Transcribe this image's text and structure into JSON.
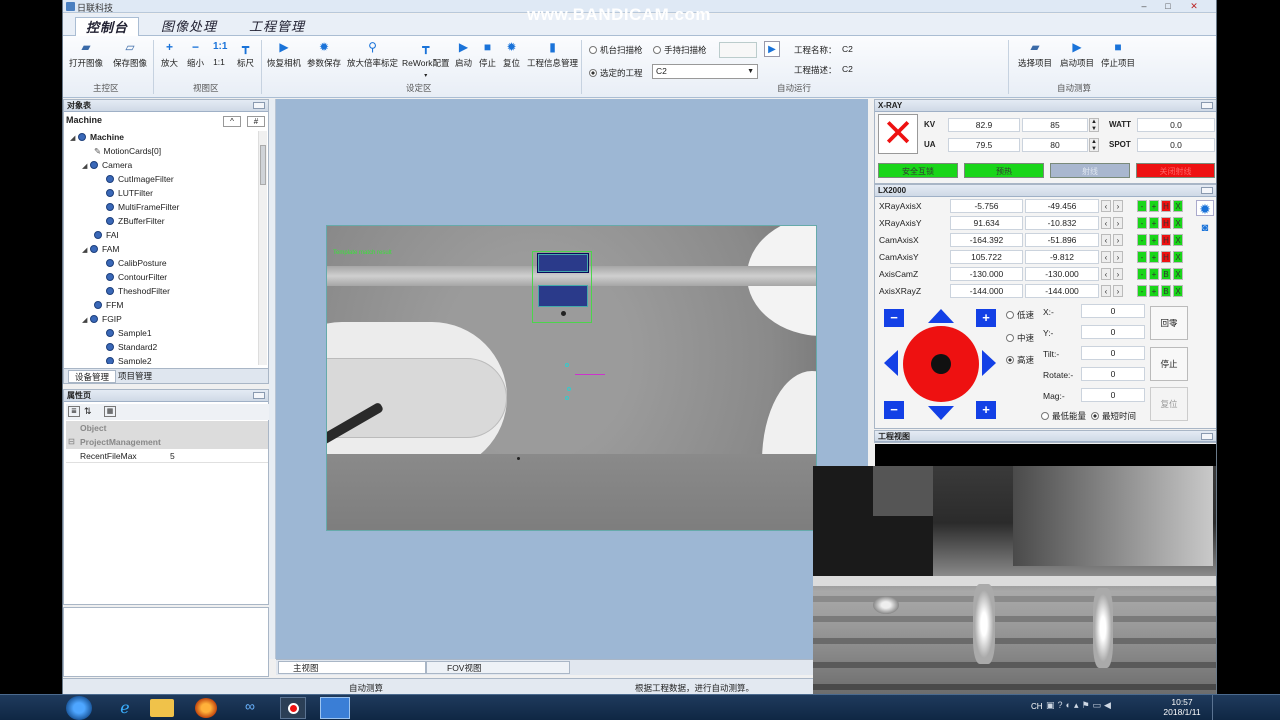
{
  "app": {
    "title": "日联科技"
  },
  "watermark": "www.BANDICAM.com",
  "tabs": [
    "控制台",
    "图像处理",
    "工程管理"
  ],
  "ribbon": {
    "buttons": [
      {
        "label": "打开图像",
        "icon": "open-image-icon"
      },
      {
        "label": "保存图像",
        "icon": "save-image-icon"
      },
      {
        "label": "放大",
        "icon": "zoom-in-icon"
      },
      {
        "label": "缩小",
        "icon": "zoom-out-icon"
      },
      {
        "label": "1:1",
        "icon": "actual-size-icon"
      },
      {
        "label": "标尺",
        "icon": "ruler-icon"
      },
      {
        "label": "恢复相机",
        "icon": "restore-camera-icon"
      },
      {
        "label": "参数保存",
        "icon": "gear-icon"
      },
      {
        "label": "放大倍率标定",
        "icon": "magnify-calibrate-icon"
      },
      {
        "label": "ReWork配置",
        "icon": "rework-icon"
      },
      {
        "label": "启动",
        "icon": "play-icon"
      },
      {
        "label": "停止",
        "icon": "stop-icon"
      },
      {
        "label": "复位",
        "icon": "reset-gear-icon"
      },
      {
        "label": "工程信息管理",
        "icon": "document-icon"
      },
      {
        "label": "选择项目",
        "icon": "folder-icon"
      },
      {
        "label": "启动项目",
        "icon": "play-icon"
      },
      {
        "label": "停止项目",
        "icon": "stop-icon"
      }
    ],
    "groups": [
      "主控区",
      "视图区",
      "设定区",
      "自动运行",
      "自动测算"
    ],
    "scan": {
      "machine": "机台扫描枪",
      "hand": "手持扫描枪",
      "selected": "选定的工程",
      "project_value": "C2"
    },
    "project": {
      "name_label": "工程名称：",
      "name_value": "C2",
      "desc_label": "工程描述：",
      "desc_value": "C2"
    }
  },
  "objects": {
    "header": "对象表",
    "root": "Machine",
    "btn_up": "^",
    "btn_hash": "#",
    "tree": [
      "Machine",
      "MotionCards[0]",
      "Camera",
      "CutImageFilter",
      "LUTFilter",
      "MultiFrameFilter",
      "ZBufferFilter",
      "FAI",
      "FAM",
      "CalibPosture",
      "ContourFilter",
      "TheshodFilter",
      "FFM",
      "FGIP",
      "Sample1",
      "Standard2",
      "Sample2"
    ],
    "tabs": [
      "设备管理",
      "项目管理"
    ]
  },
  "props": {
    "header": "属性页",
    "cat1": "Object",
    "cat2": "ProjectManagement",
    "key": "RecentFileMax",
    "value": "5"
  },
  "viewer": {
    "overlay_text": "Template match result",
    "tabs": [
      "主视图",
      "FOV视图"
    ]
  },
  "xray": {
    "header": "X-RAY",
    "kv_label": "KV",
    "kv_value": "82.9",
    "kv_set": "85",
    "watt_label": "WATT",
    "watt_value": "0.0",
    "ua_label": "UA",
    "ua_value": "79.5",
    "ua_set": "80",
    "spot_label": "SPOT",
    "spot_value": "0.0",
    "buttons": [
      {
        "label": "安全互锁",
        "color": "#19d619"
      },
      {
        "label": "预热",
        "color": "#19d619"
      },
      {
        "label": "射线",
        "color": "#a9b7cf"
      },
      {
        "label": "关闭射线",
        "color": "#ee1111"
      }
    ]
  },
  "lx": {
    "header": "LX2000",
    "axes": [
      {
        "name": "XRayAxisX",
        "v1": "-5.756",
        "v2": "-49.456"
      },
      {
        "name": "XRayAxisY",
        "v1": "91.634",
        "v2": "-10.832"
      },
      {
        "name": "CamAxisX",
        "v1": "-164.392",
        "v2": "-51.896"
      },
      {
        "name": "CamAxisY",
        "v1": "105.722",
        "v2": "-9.812"
      },
      {
        "name": "AxisCamZ",
        "v1": "-130.000",
        "v2": "-130.000"
      },
      {
        "name": "AxisXRayZ",
        "v1": "-144.000",
        "v2": "-144.000"
      }
    ],
    "speeds": [
      "低速",
      "中速",
      "高速"
    ],
    "coords": [
      {
        "label": "X:-",
        "value": "0"
      },
      {
        "label": "Y:-",
        "value": "0"
      },
      {
        "label": "Tilt:-",
        "value": "0"
      },
      {
        "label": "Rotate:-",
        "value": "0"
      },
      {
        "label": "Mag:-",
        "value": "0"
      }
    ],
    "btn_home": "回零",
    "btn_stop": "停止",
    "btn_reset": "复位",
    "mode_low": "最低能量",
    "mode_short": "最短时间"
  },
  "video": {
    "header": "工程视图"
  },
  "status": {
    "left": "自动测算",
    "mid": "根据工程数据，进行自动测算。"
  },
  "taskbar": {
    "lang": "CH",
    "time": "10:57",
    "date": "2018/1/11"
  },
  "colors": {
    "accent": "#1a73d9",
    "canvas": "#9db7d4",
    "red": "#ee1111",
    "green": "#19d619"
  }
}
